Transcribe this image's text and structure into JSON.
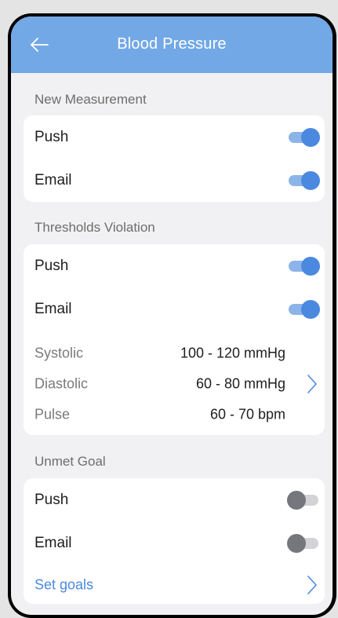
{
  "header": {
    "title": "Blood Pressure",
    "back_icon": "arrow-left-icon"
  },
  "colors": {
    "accent": "#73a8e6",
    "toggle_on": "#4b89e0",
    "toggle_off": "#75777d",
    "background": "#f1f1f3"
  },
  "sections": {
    "new_measurement": {
      "header": "New Measurement",
      "push_label": "Push",
      "push_enabled": true,
      "email_label": "Email",
      "email_enabled": true
    },
    "thresholds_violation": {
      "header": "Thresholds Violation",
      "push_label": "Push",
      "push_enabled": true,
      "email_label": "Email",
      "email_enabled": true,
      "thresholds": [
        {
          "label": "Systolic",
          "value": "100 - 120 mmHg"
        },
        {
          "label": "Diastolic",
          "value": "60 - 80 mmHg"
        },
        {
          "label": "Pulse",
          "value": "60 - 70 bpm"
        }
      ],
      "chevron_icon": "chevron-right-icon"
    },
    "unmet_goal": {
      "header": "Unmet Goal",
      "push_label": "Push",
      "push_enabled": false,
      "email_label": "Email",
      "email_enabled": false,
      "set_goals_label": "Set goals",
      "chevron_icon": "chevron-right-icon"
    }
  }
}
